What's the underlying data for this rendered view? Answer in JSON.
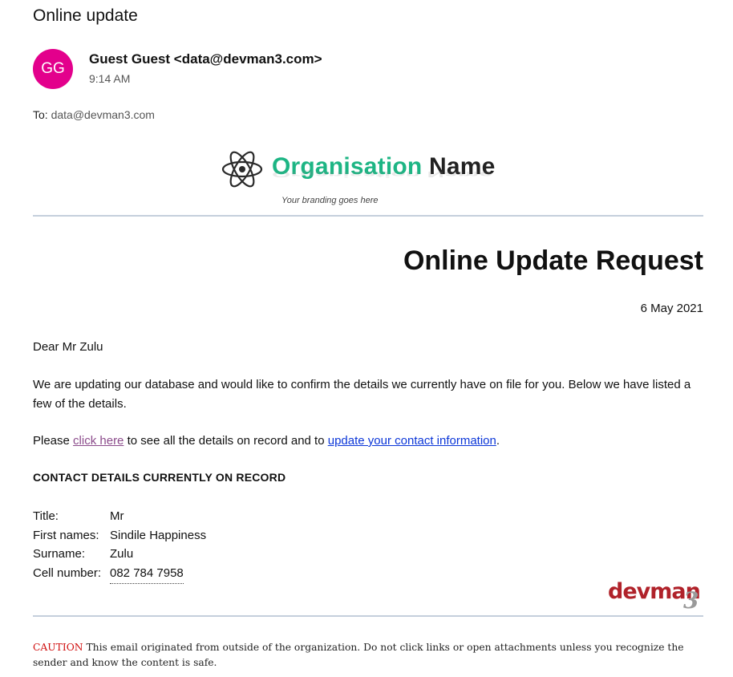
{
  "email": {
    "subject": "Online update",
    "avatar_initials": "GG",
    "sender": "Guest Guest <data@devman3.com>",
    "time": "9:14 AM",
    "to_label": "To:",
    "to_address": "data@devman3.com"
  },
  "branding": {
    "org_part1": "Organisation",
    "org_part2": "Name",
    "tagline": "Your branding goes here",
    "accent_color": "#1db584",
    "icon": "atom-icon"
  },
  "letter": {
    "title": "Online Update Request",
    "date": "6 May 2021",
    "greeting": "Dear Mr Zulu",
    "intro": "We are updating our database and would like to confirm the details we currently have on file for you. Below we have listed a few of the details.",
    "please_prefix": "Please ",
    "click_here": "click here",
    "please_middle": " to see all the details on record and to ",
    "update_link": "update your contact information",
    "please_suffix": ".",
    "section_heading": "CONTACT DETAILS CURRENTLY ON RECORD",
    "details": {
      "title_label": "Title:",
      "title_value": "Mr",
      "first_label": "First names:",
      "first_value": "Sindile Happiness",
      "surname_label": "Surname:",
      "surname_value": "Zulu",
      "cell_label": "Cell number:",
      "cell_value": "082 784 7958"
    }
  },
  "footer": {
    "logo_word": "devman",
    "logo_number": "3",
    "caution_word": "CAUTION",
    "caution_text": " This email originated from outside of the organization. Do not click links or open attachments unless you recognize the sender and know the content is safe.",
    "caution_color": "#d01010"
  }
}
